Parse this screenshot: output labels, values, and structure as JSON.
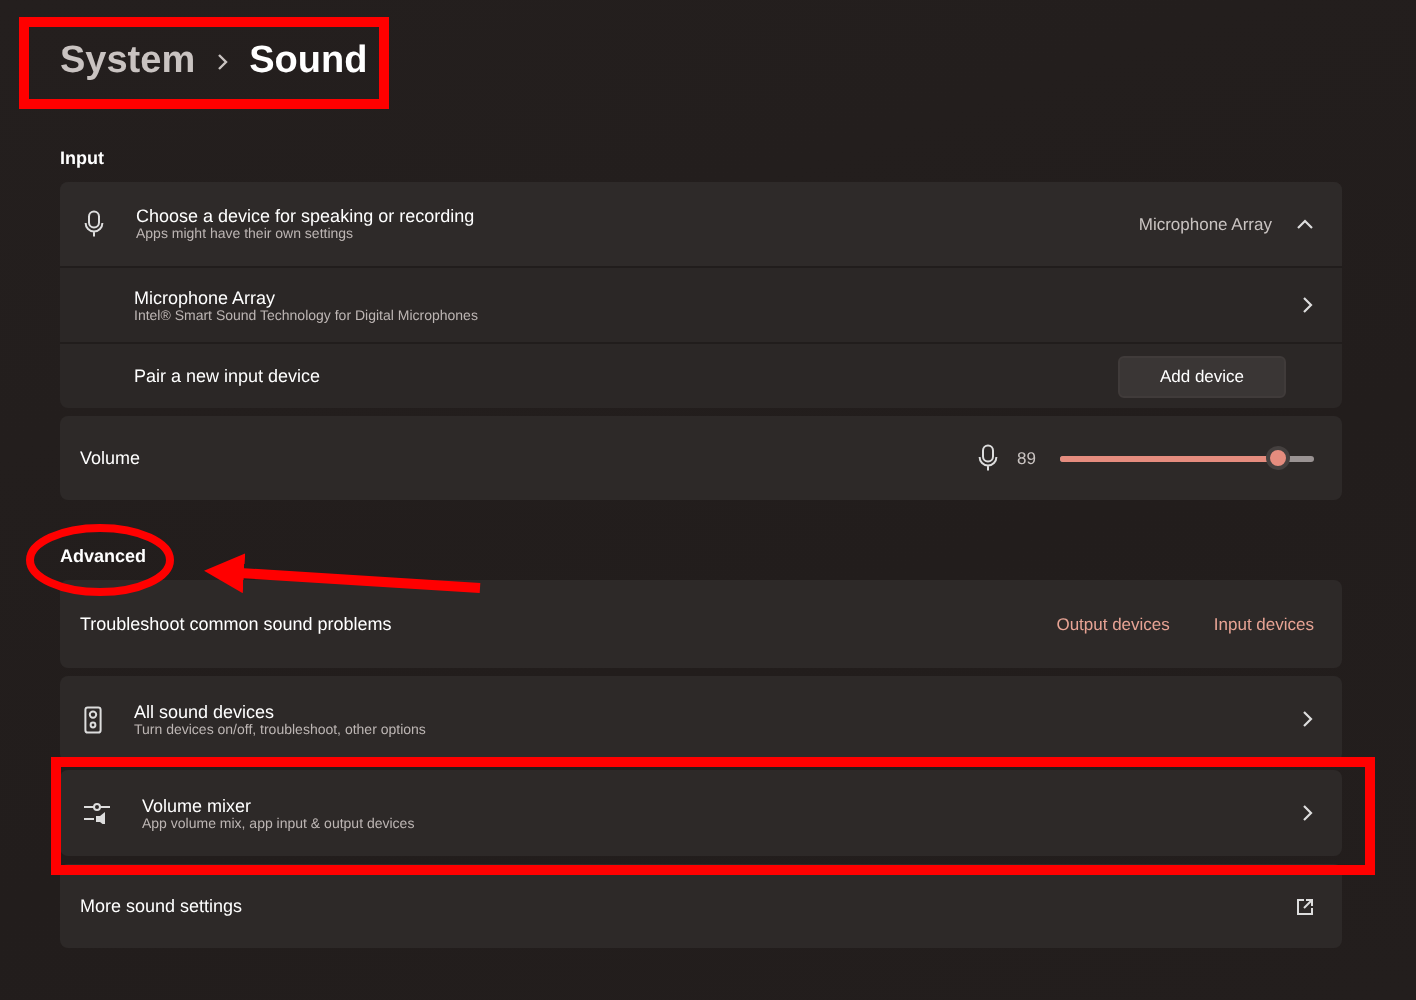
{
  "breadcrumb": [
    {
      "label": "System",
      "current": false
    },
    {
      "label": "Sound",
      "current": true
    }
  ],
  "input": {
    "heading": "Input",
    "device_chooser": {
      "title": "Choose a device for speaking or recording",
      "subtitle": "Apps might have their own settings",
      "value": "Microphone Array",
      "expanded": true
    },
    "devices": [
      {
        "name": "Microphone Array",
        "description": "Intel® Smart Sound Technology for Digital Microphones"
      }
    ],
    "pair": {
      "label": "Pair a new input device",
      "button": "Add device"
    },
    "volume": {
      "label": "Volume",
      "reading": "89",
      "level": 0.86
    }
  },
  "advanced": {
    "heading": "Advanced",
    "troubleshoot": {
      "label": "Troubleshoot common sound problems",
      "links": [
        "Output devices",
        "Input devices"
      ]
    },
    "items": [
      {
        "kind": "devices",
        "title": "All sound devices",
        "subtitle": "Turn devices on/off, troubleshoot, other options"
      },
      {
        "kind": "mixer",
        "title": "Volume mixer",
        "subtitle": "App volume mix, app input & output devices"
      },
      {
        "kind": "external",
        "title": "More sound settings"
      }
    ]
  },
  "annotations": [
    {
      "kind": "rectangle"
    },
    {
      "kind": "ellipse"
    },
    {
      "kind": "arrow"
    },
    {
      "kind": "rectangle"
    }
  ]
}
